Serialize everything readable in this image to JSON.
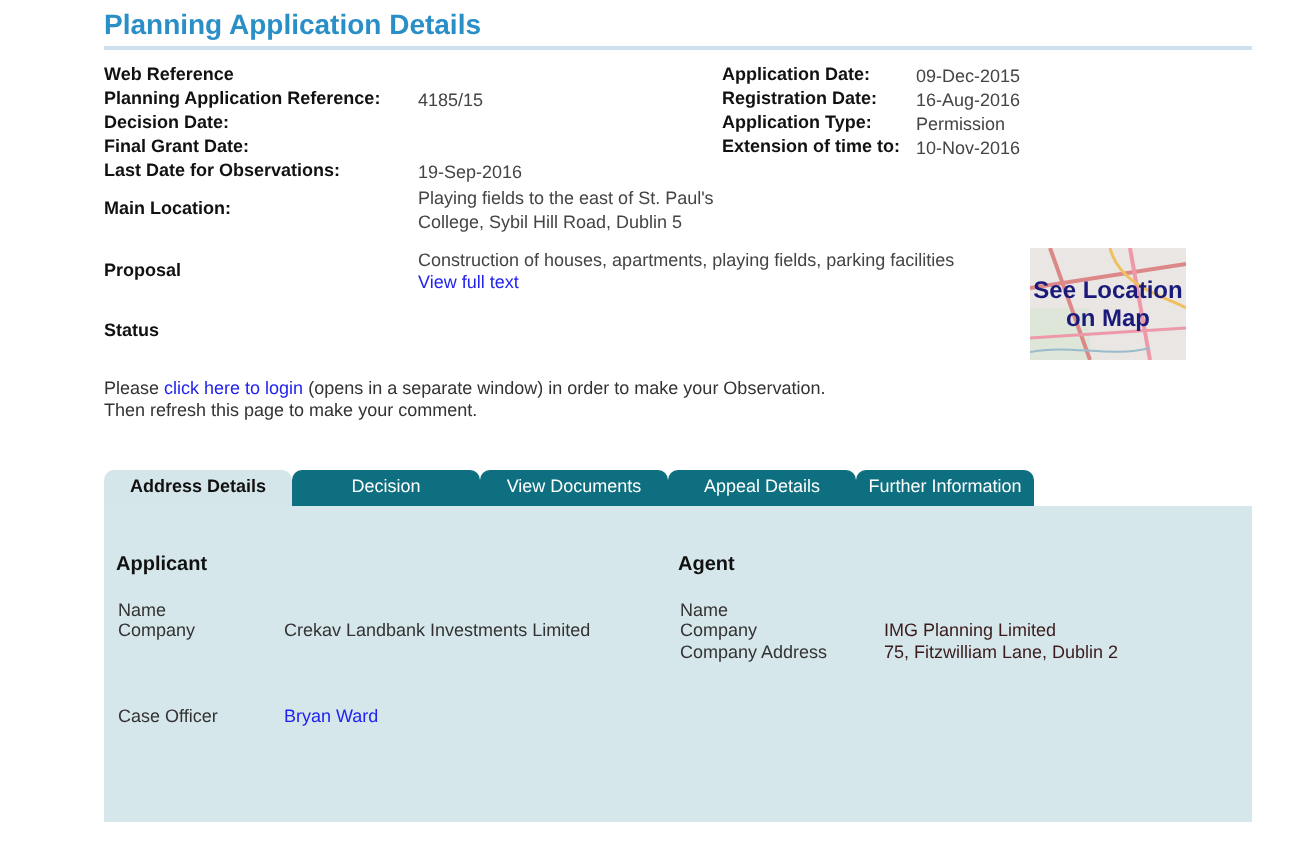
{
  "title": "Planning Application Details",
  "left_fields": [
    {
      "label": "Web Reference"
    },
    {
      "label": "Planning Application Reference:",
      "value": "4185/15"
    },
    {
      "label": "Decision Date:"
    },
    {
      "label": "Final Grant Date:"
    },
    {
      "label": "Last Date for Observations:",
      "value": "19-Sep-2016"
    },
    {
      "label": "Main Location:",
      "value": "Playing fields to the east of St. Paul's College, Sybil Hill Road, Dublin 5"
    }
  ],
  "right_fields": [
    {
      "label": "Application Date:",
      "value": "09-Dec-2015"
    },
    {
      "label": "Registration Date:",
      "value": "16-Aug-2016"
    },
    {
      "label": "Application Type:",
      "value": "Permission"
    },
    {
      "label": "Extension of time to:",
      "value": "10-Nov-2016"
    }
  ],
  "proposal": {
    "label": "Proposal",
    "value": "Construction of houses, apartments, playing fields, parking facilities",
    "link": "View full text"
  },
  "map_link": {
    "label": "See Location on Map"
  },
  "status": {
    "label": "Status"
  },
  "login_note": {
    "before": "Please ",
    "link": "click here to login",
    "after": " (opens in a separate window) in order to make your Observation.",
    "line2": "Then refresh this page to make your comment."
  },
  "tabs": [
    {
      "label": "Address Details",
      "selected": true
    },
    {
      "label": "Decision",
      "selected": false
    },
    {
      "label": "View Documents",
      "selected": false
    },
    {
      "label": "Appeal Details",
      "selected": false
    },
    {
      "label": "Further Information",
      "selected": false
    }
  ],
  "applicant": {
    "heading": "Applicant",
    "fields": [
      {
        "label": "Name"
      },
      {
        "label": "Company",
        "value": "Crekav Landbank Investments Limited"
      }
    ]
  },
  "agent": {
    "heading": "Agent",
    "fields": [
      {
        "label": "Name"
      },
      {
        "label": "Company",
        "value": "IMG Planning Limited"
      },
      {
        "label": "Company Address",
        "value": "75, Fitzwilliam Lane, Dublin 2"
      }
    ]
  },
  "case_officer": {
    "label": "Case Officer",
    "value": "Bryan Ward"
  }
}
